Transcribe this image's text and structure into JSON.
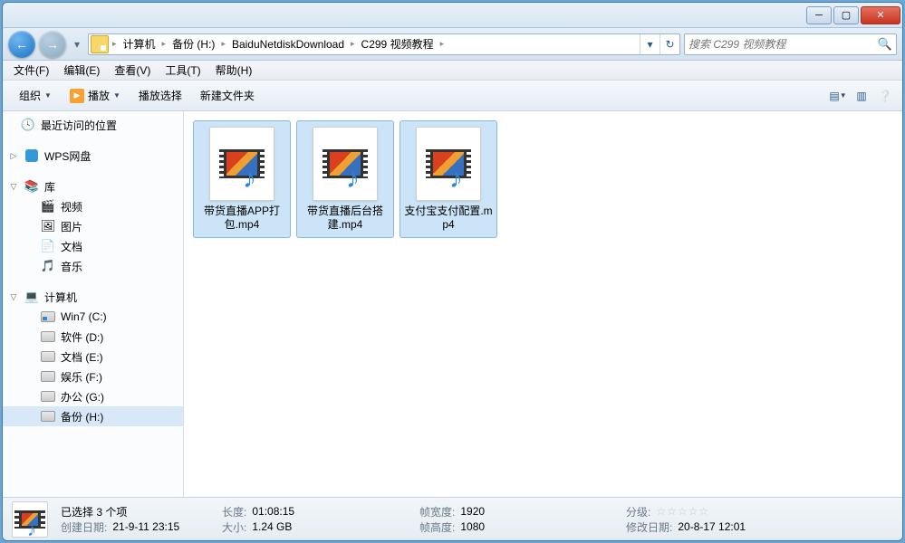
{
  "titlebar": {},
  "nav": {
    "breadcrumb": [
      "计算机",
      "备份 (H:)",
      "BaiduNetdiskDownload",
      "C299 视频教程"
    ],
    "search_placeholder": "搜索 C299 视频教程"
  },
  "menu": {
    "file": "文件(F)",
    "edit": "编辑(E)",
    "view": "查看(V)",
    "tools": "工具(T)",
    "help": "帮助(H)"
  },
  "toolbar": {
    "organize": "组织",
    "play": "播放",
    "playsel": "播放选择",
    "newfolder": "新建文件夹"
  },
  "sidebar": {
    "recent": "最近访问的位置",
    "wps": "WPS网盘",
    "lib": "库",
    "video": "视频",
    "pic": "图片",
    "doc": "文档",
    "music": "音乐",
    "pc": "计算机",
    "drives": [
      "Win7 (C:)",
      "软件 (D:)",
      "文档 (E:)",
      "娱乐 (F:)",
      "办公 (G:)",
      "备份 (H:)"
    ]
  },
  "files": [
    {
      "name": "带货直播APP打包.mp4",
      "selected": true
    },
    {
      "name": "带货直播后台搭建.mp4",
      "selected": true
    },
    {
      "name": "支付宝支付配置.mp4",
      "selected": true
    }
  ],
  "status": {
    "selected": "已选择 3 个项",
    "length_lab": "长度:",
    "length_val": "01:08:15",
    "size_lab": "大小:",
    "size_val": "1.24 GB",
    "fw_lab": "帧宽度:",
    "fw_val": "1920",
    "fh_lab": "帧高度:",
    "fh_val": "1080",
    "rating_lab": "分级:",
    "mdate_lab": "修改日期:",
    "mdate_val": "20-8-17 12:01",
    "cdate_lab": "创建日期:",
    "cdate_val": "21-9-11 23:15"
  }
}
